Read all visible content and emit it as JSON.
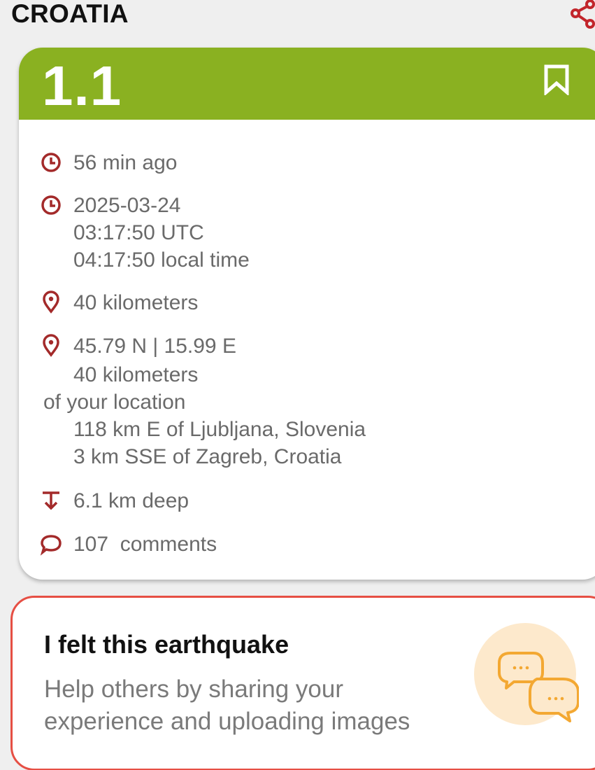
{
  "header": {
    "title": "CROATIA",
    "share_icon": "share-icon"
  },
  "quake": {
    "magnitude": "1.1",
    "magnitude_color": "#8ab121",
    "bookmark_icon": "bookmark-icon",
    "time_ago": "56 min ago",
    "date": "2025-03-24",
    "utc_time": "03:17:50 UTC",
    "local_time": "04:17:50 local time",
    "distance": "40 kilometers",
    "coordinates": "45.79 N | 15.99 E",
    "distance_2": "40 kilometers",
    "of_location": "of your location",
    "nearby_1": "118 km E of Ljubljana, Slovenia",
    "nearby_2": "3 km SSE of Zagreb, Croatia",
    "depth": "6.1 km deep",
    "comments": "107  comments",
    "icon_color": "#a32a2a"
  },
  "felt": {
    "title": "I felt this earthquake",
    "line_1": "Help others by sharing your",
    "line_2": "experience and uploading images",
    "accent": "#e64f44",
    "icon": "chat-bubbles-icon"
  }
}
